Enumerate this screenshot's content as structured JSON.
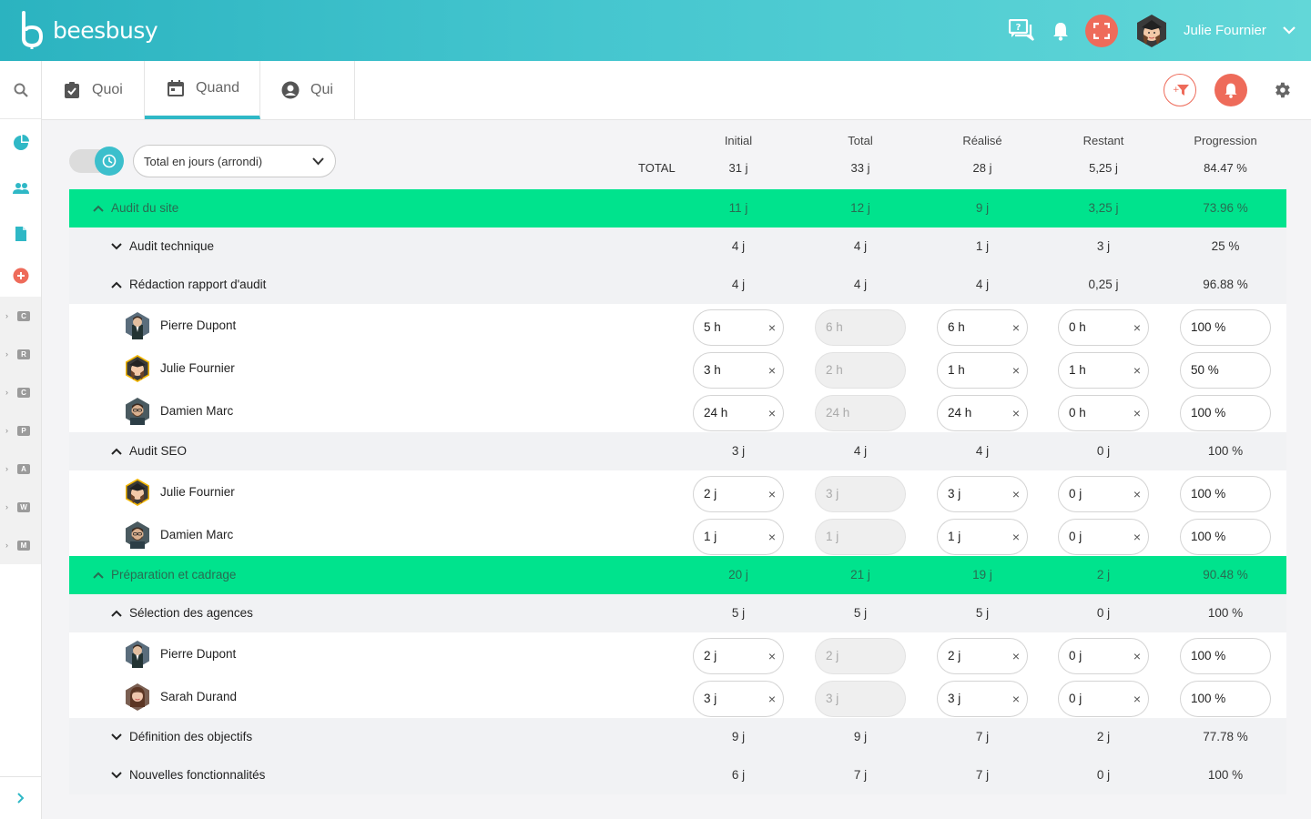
{
  "app": {
    "brand": "beesbusy"
  },
  "header": {
    "user_name": "Julie Fournier"
  },
  "tabs": [
    {
      "label": "Quoi",
      "icon": "clipboard-check-icon"
    },
    {
      "label": "Quand",
      "icon": "calendar-icon"
    },
    {
      "label": "Qui",
      "icon": "user-circle-icon"
    }
  ],
  "sidebar": {
    "letters": [
      "C",
      "R",
      "C",
      "P",
      "A",
      "W",
      "M"
    ]
  },
  "toolbar": {
    "display_mode": "Total en jours (arrondi)"
  },
  "columns": [
    "Initial",
    "Total",
    "Réalisé",
    "Restant",
    "Progression"
  ],
  "total": {
    "label": "TOTAL",
    "values": [
      "31 j",
      "33 j",
      "28 j",
      "5,25 j",
      "84.47 %"
    ]
  },
  "rows": [
    {
      "kind": "group",
      "caret": "up",
      "label": "Audit du site",
      "values": [
        "11 j",
        "12 j",
        "9 j",
        "3,25 j",
        "73.96 %"
      ]
    },
    {
      "kind": "task",
      "caret": "down",
      "label": "Audit technique",
      "values": [
        "4 j",
        "4 j",
        "1 j",
        "3 j",
        "25 %"
      ]
    },
    {
      "kind": "task",
      "caret": "up",
      "label": "Rédaction rapport d'audit",
      "values": [
        "4 j",
        "4 j",
        "4 j",
        "0,25 j",
        "96.88 %"
      ]
    },
    {
      "kind": "person",
      "avatar": "pierre",
      "label": "Pierre Dupont",
      "values": [
        "5 h",
        "6 h",
        "6 h",
        "0 h",
        "100 %"
      ]
    },
    {
      "kind": "person",
      "avatar": "julie",
      "label": "Julie Fournier",
      "values": [
        "3 h",
        "2 h",
        "1 h",
        "1 h",
        "50 %"
      ]
    },
    {
      "kind": "person",
      "avatar": "damien",
      "label": "Damien Marc",
      "values": [
        "24 h",
        "24 h",
        "24 h",
        "0 h",
        "100 %"
      ]
    },
    {
      "kind": "task",
      "caret": "up",
      "label": "Audit SEO",
      "values": [
        "3 j",
        "4 j",
        "4 j",
        "0 j",
        "100 %"
      ]
    },
    {
      "kind": "person",
      "avatar": "julie",
      "label": "Julie Fournier",
      "values": [
        "2 j",
        "3 j",
        "3 j",
        "0 j",
        "100 %"
      ]
    },
    {
      "kind": "person",
      "avatar": "damien",
      "label": "Damien Marc",
      "values": [
        "1 j",
        "1 j",
        "1 j",
        "0 j",
        "100 %"
      ]
    },
    {
      "kind": "group",
      "caret": "up",
      "label": "Préparation et cadrage",
      "values": [
        "20 j",
        "21 j",
        "19 j",
        "2 j",
        "90.48 %"
      ]
    },
    {
      "kind": "task",
      "caret": "up",
      "label": "Sélection des agences",
      "values": [
        "5 j",
        "5 j",
        "5 j",
        "0 j",
        "100 %"
      ]
    },
    {
      "kind": "person",
      "avatar": "pierre",
      "label": "Pierre Dupont",
      "values": [
        "2 j",
        "2 j",
        "2 j",
        "0 j",
        "100 %"
      ]
    },
    {
      "kind": "person",
      "avatar": "sarah",
      "label": "Sarah Durand",
      "values": [
        "3 j",
        "3 j",
        "3 j",
        "0 j",
        "100 %"
      ]
    },
    {
      "kind": "task",
      "caret": "down",
      "label": "Définition des objectifs",
      "values": [
        "9 j",
        "9 j",
        "7 j",
        "2 j",
        "77.78 %"
      ]
    },
    {
      "kind": "task",
      "caret": "down",
      "label": "Nouvelles fonctionnalités",
      "values": [
        "6 j",
        "7 j",
        "7 j",
        "0 j",
        "100 %"
      ]
    }
  ],
  "colors": {
    "accent": "#2fb8c6",
    "group_row": "#00e38d",
    "alert": "#ee6b5a"
  }
}
